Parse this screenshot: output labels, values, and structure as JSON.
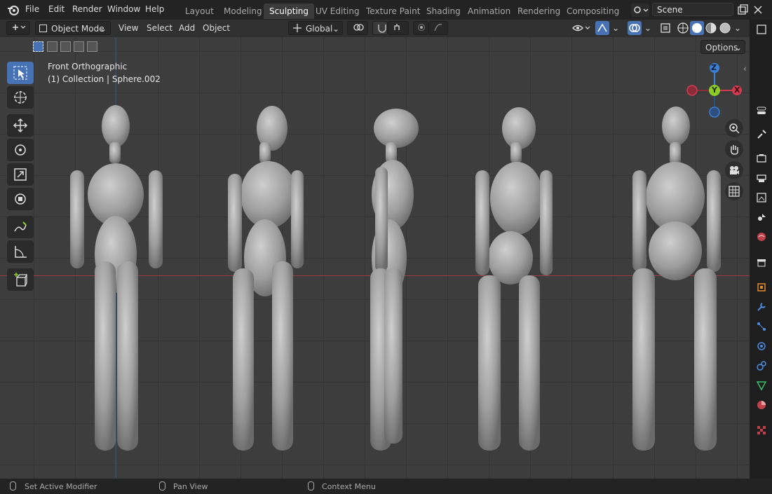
{
  "menu": {
    "items": [
      "File",
      "Edit",
      "Render",
      "Window",
      "Help"
    ]
  },
  "workspaces": {
    "tabs": [
      "Layout",
      "Modeling",
      "Sculpting",
      "UV Editing",
      "Texture Paint",
      "Shading",
      "Animation",
      "Rendering",
      "Compositing"
    ],
    "active": "Sculpting"
  },
  "scene": {
    "name": "Scene"
  },
  "header": {
    "mode": "Object Mode",
    "menus": [
      "View",
      "Select",
      "Add",
      "Object"
    ],
    "orientation": "Global",
    "options_label": "Options"
  },
  "viewport": {
    "view_name": "Front Orthographic",
    "collection_info": "(1) Collection | Sphere.002",
    "gizmo": {
      "z": "Z",
      "y": "Y",
      "x": "X"
    }
  },
  "statusbar": {
    "items": [
      "Set Active Modifier",
      "Pan View",
      "Context Menu"
    ]
  },
  "colors": {
    "accent": "#4772b3",
    "x_axis": "#d23b4f",
    "y_axis": "#8ccc2a",
    "z_axis": "#3a7fd4"
  }
}
